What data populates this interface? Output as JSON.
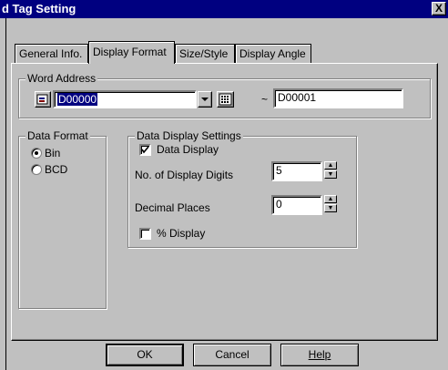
{
  "window": {
    "title": "d Tag Setting",
    "close_glyph": "X"
  },
  "tabs": [
    {
      "label": "General Info."
    },
    {
      "label": "Display Format"
    },
    {
      "label": "Size/Style"
    },
    {
      "label": "Display Angle"
    }
  ],
  "word_address": {
    "legend": "Word Address",
    "address_value": "D00000",
    "range_separator": "~",
    "end_address": "D00001"
  },
  "data_format": {
    "legend": "Data Format",
    "options": [
      {
        "label": "Bin",
        "selected": true
      },
      {
        "label": "BCD",
        "selected": false
      }
    ]
  },
  "data_display_settings": {
    "legend": "Data Display Settings",
    "data_display": {
      "label": "Data Display",
      "checked": true
    },
    "display_digits": {
      "label": "No. of Display Digits",
      "value": "5"
    },
    "decimal_places": {
      "label": "Decimal Places",
      "value": "0"
    },
    "percent_display": {
      "label": "% Display",
      "checked": false
    }
  },
  "buttons": {
    "ok": "OK",
    "cancel": "Cancel",
    "help": "Help"
  },
  "icons": {
    "address_input": "bit-address-icon",
    "keypad": "keypad-icon",
    "dropdown": "chevron-down-icon"
  }
}
